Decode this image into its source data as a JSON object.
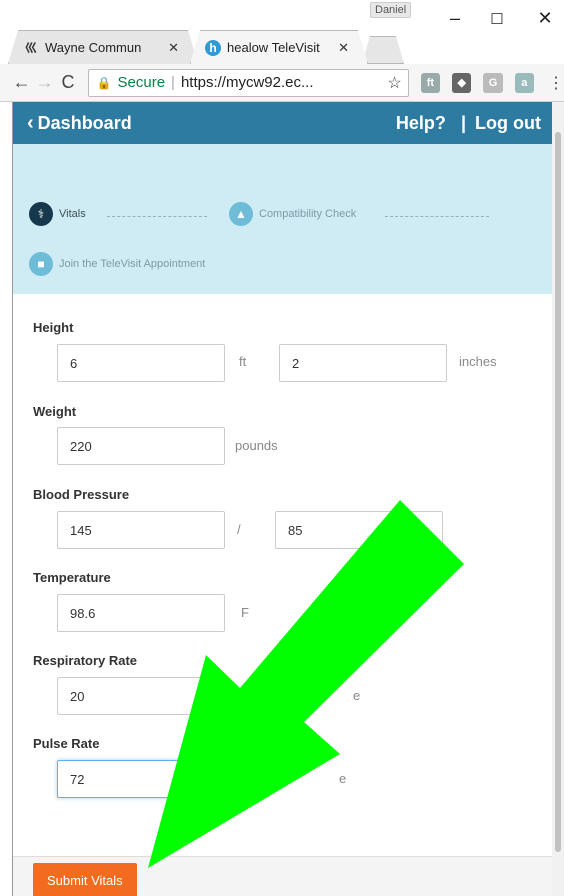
{
  "browser": {
    "profile_name": "Daniel",
    "tabs": [
      {
        "title": "Wayne Commun",
        "active": false
      },
      {
        "title": "healow TeleVisit",
        "active": true
      }
    ],
    "address": {
      "secure_label": "Secure",
      "url": "https://mycw92.ec..."
    }
  },
  "appbar": {
    "back_label": "Dashboard",
    "help_label": "Help?",
    "separator": "|",
    "logout_label": "Log out"
  },
  "steps": [
    {
      "label": "Vitals",
      "status": "current"
    },
    {
      "label": "Compatibility Check",
      "status": "pending"
    },
    {
      "label": "Join the TeleVisit Appointment",
      "status": "pending"
    }
  ],
  "form": {
    "height": {
      "label": "Height",
      "feet": "6",
      "feet_unit": "ft",
      "inches": "2",
      "inches_unit": "inches"
    },
    "weight": {
      "label": "Weight",
      "value": "220",
      "unit": "pounds"
    },
    "blood_pressure": {
      "label": "Blood Pressure",
      "systolic": "145",
      "separator": "/",
      "diastolic": "85"
    },
    "temperature": {
      "label": "Temperature",
      "value": "98.6",
      "unit": "F"
    },
    "respiratory_rate": {
      "label": "Respiratory Rate",
      "value": "20",
      "unit": "e"
    },
    "pulse_rate": {
      "label": "Pulse Rate",
      "value": "72",
      "unit": "e"
    }
  },
  "footer": {
    "submit_label": "Submit Vitals"
  },
  "colors": {
    "appbar": "#2e7ba2",
    "steps_bg": "#cfebf4",
    "submit": "#f26b21",
    "arrow": "#00ff00"
  }
}
